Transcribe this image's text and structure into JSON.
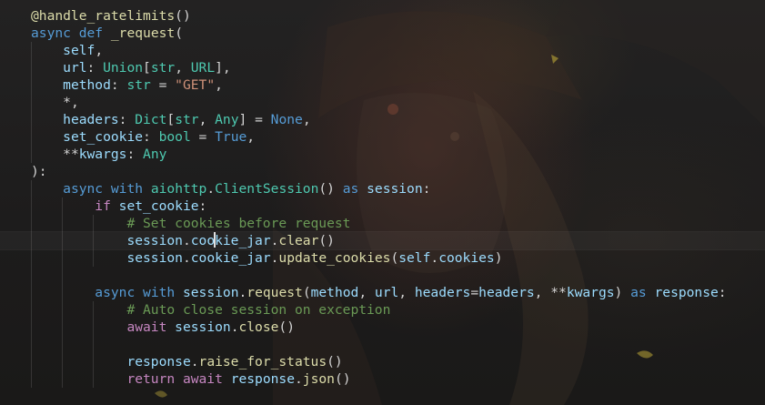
{
  "editor": {
    "language": "python",
    "theme_colors": {
      "keyword": "#569cd6",
      "function": "#dcdcaa",
      "parameter": "#9cdcfe",
      "type": "#4ec9b0",
      "string": "#ce9178",
      "comment": "#6a9955",
      "control": "#c586c0",
      "text": "#d4d4d4"
    },
    "cursor": {
      "line": 13,
      "column": 23
    },
    "lines": [
      {
        "indent": 0,
        "tokens": [
          {
            "t": "@handle_ratelimits",
            "c": "dec"
          },
          {
            "t": "()",
            "c": "pl"
          }
        ]
      },
      {
        "indent": 0,
        "tokens": [
          {
            "t": "async",
            "c": "kw"
          },
          {
            "t": " ",
            "c": "pl"
          },
          {
            "t": "def",
            "c": "kw"
          },
          {
            "t": " ",
            "c": "pl"
          },
          {
            "t": "_request",
            "c": "fn"
          },
          {
            "t": "(",
            "c": "pl"
          }
        ]
      },
      {
        "indent": 1,
        "tokens": [
          {
            "t": "self",
            "c": "par"
          },
          {
            "t": ",",
            "c": "pl"
          }
        ]
      },
      {
        "indent": 1,
        "tokens": [
          {
            "t": "url",
            "c": "par"
          },
          {
            "t": ": ",
            "c": "pl"
          },
          {
            "t": "Union",
            "c": "typ"
          },
          {
            "t": "[",
            "c": "pl"
          },
          {
            "t": "str",
            "c": "typ"
          },
          {
            "t": ", ",
            "c": "pl"
          },
          {
            "t": "URL",
            "c": "typ"
          },
          {
            "t": "],",
            "c": "pl"
          }
        ]
      },
      {
        "indent": 1,
        "tokens": [
          {
            "t": "method",
            "c": "par"
          },
          {
            "t": ": ",
            "c": "pl"
          },
          {
            "t": "str",
            "c": "typ"
          },
          {
            "t": " = ",
            "c": "pl"
          },
          {
            "t": "\"GET\"",
            "c": "str"
          },
          {
            "t": ",",
            "c": "pl"
          }
        ]
      },
      {
        "indent": 1,
        "tokens": [
          {
            "t": "*,",
            "c": "pl"
          }
        ]
      },
      {
        "indent": 1,
        "tokens": [
          {
            "t": "headers",
            "c": "par"
          },
          {
            "t": ": ",
            "c": "pl"
          },
          {
            "t": "Dict",
            "c": "typ"
          },
          {
            "t": "[",
            "c": "pl"
          },
          {
            "t": "str",
            "c": "typ"
          },
          {
            "t": ", ",
            "c": "pl"
          },
          {
            "t": "Any",
            "c": "typ"
          },
          {
            "t": "] = ",
            "c": "pl"
          },
          {
            "t": "None",
            "c": "con"
          },
          {
            "t": ",",
            "c": "pl"
          }
        ]
      },
      {
        "indent": 1,
        "tokens": [
          {
            "t": "set_cookie",
            "c": "par"
          },
          {
            "t": ": ",
            "c": "pl"
          },
          {
            "t": "bool",
            "c": "typ"
          },
          {
            "t": " = ",
            "c": "pl"
          },
          {
            "t": "True",
            "c": "con"
          },
          {
            "t": ",",
            "c": "pl"
          }
        ]
      },
      {
        "indent": 1,
        "tokens": [
          {
            "t": "**",
            "c": "pl"
          },
          {
            "t": "kwargs",
            "c": "par"
          },
          {
            "t": ": ",
            "c": "pl"
          },
          {
            "t": "Any",
            "c": "typ"
          }
        ]
      },
      {
        "indent": 0,
        "tokens": [
          {
            "t": "):",
            "c": "pl"
          }
        ]
      },
      {
        "indent": 1,
        "tokens": [
          {
            "t": "async",
            "c": "kw"
          },
          {
            "t": " ",
            "c": "pl"
          },
          {
            "t": "with",
            "c": "kw"
          },
          {
            "t": " ",
            "c": "pl"
          },
          {
            "t": "aiohttp",
            "c": "typ"
          },
          {
            "t": ".",
            "c": "pl"
          },
          {
            "t": "ClientSession",
            "c": "typ"
          },
          {
            "t": "() ",
            "c": "pl"
          },
          {
            "t": "as",
            "c": "kw"
          },
          {
            "t": " ",
            "c": "pl"
          },
          {
            "t": "session",
            "c": "var"
          },
          {
            "t": ":",
            "c": "pl"
          }
        ]
      },
      {
        "indent": 2,
        "tokens": [
          {
            "t": "if",
            "c": "ctl"
          },
          {
            "t": " ",
            "c": "pl"
          },
          {
            "t": "set_cookie",
            "c": "var"
          },
          {
            "t": ":",
            "c": "pl"
          }
        ]
      },
      {
        "indent": 3,
        "tokens": [
          {
            "t": "# Set cookies before request",
            "c": "cm"
          }
        ]
      },
      {
        "indent": 3,
        "tokens": [
          {
            "t": "session",
            "c": "var"
          },
          {
            "t": ".",
            "c": "pl"
          },
          {
            "t": "cookie_jar",
            "c": "var"
          },
          {
            "t": ".",
            "c": "pl"
          },
          {
            "t": "clear",
            "c": "fn"
          },
          {
            "t": "()",
            "c": "pl"
          }
        ]
      },
      {
        "indent": 3,
        "tokens": [
          {
            "t": "session",
            "c": "var"
          },
          {
            "t": ".",
            "c": "pl"
          },
          {
            "t": "cookie_jar",
            "c": "var"
          },
          {
            "t": ".",
            "c": "pl"
          },
          {
            "t": "update_cookies",
            "c": "fn"
          },
          {
            "t": "(",
            "c": "pl"
          },
          {
            "t": "self",
            "c": "var"
          },
          {
            "t": ".",
            "c": "pl"
          },
          {
            "t": "cookies",
            "c": "var"
          },
          {
            "t": ")",
            "c": "pl"
          }
        ]
      },
      {
        "indent": 2,
        "tokens": []
      },
      {
        "indent": 2,
        "tokens": [
          {
            "t": "async",
            "c": "kw"
          },
          {
            "t": " ",
            "c": "pl"
          },
          {
            "t": "with",
            "c": "kw"
          },
          {
            "t": " ",
            "c": "pl"
          },
          {
            "t": "session",
            "c": "var"
          },
          {
            "t": ".",
            "c": "pl"
          },
          {
            "t": "request",
            "c": "fn"
          },
          {
            "t": "(",
            "c": "pl"
          },
          {
            "t": "method",
            "c": "var"
          },
          {
            "t": ", ",
            "c": "pl"
          },
          {
            "t": "url",
            "c": "var"
          },
          {
            "t": ", ",
            "c": "pl"
          },
          {
            "t": "headers",
            "c": "par"
          },
          {
            "t": "=",
            "c": "pl"
          },
          {
            "t": "headers",
            "c": "var"
          },
          {
            "t": ", ",
            "c": "pl"
          },
          {
            "t": "**",
            "c": "pl"
          },
          {
            "t": "kwargs",
            "c": "var"
          },
          {
            "t": ") ",
            "c": "pl"
          },
          {
            "t": "as",
            "c": "kw"
          },
          {
            "t": " ",
            "c": "pl"
          },
          {
            "t": "response",
            "c": "var"
          },
          {
            "t": ":",
            "c": "pl"
          }
        ]
      },
      {
        "indent": 3,
        "tokens": [
          {
            "t": "# Auto close session on exception",
            "c": "cm"
          }
        ]
      },
      {
        "indent": 3,
        "tokens": [
          {
            "t": "await",
            "c": "ctl"
          },
          {
            "t": " ",
            "c": "pl"
          },
          {
            "t": "session",
            "c": "var"
          },
          {
            "t": ".",
            "c": "pl"
          },
          {
            "t": "close",
            "c": "fn"
          },
          {
            "t": "()",
            "c": "pl"
          }
        ]
      },
      {
        "indent": 3,
        "tokens": []
      },
      {
        "indent": 3,
        "tokens": [
          {
            "t": "response",
            "c": "var"
          },
          {
            "t": ".",
            "c": "pl"
          },
          {
            "t": "raise_for_status",
            "c": "fn"
          },
          {
            "t": "()",
            "c": "pl"
          }
        ]
      },
      {
        "indent": 3,
        "tokens": [
          {
            "t": "return",
            "c": "ctl"
          },
          {
            "t": " ",
            "c": "pl"
          },
          {
            "t": "await",
            "c": "ctl"
          },
          {
            "t": " ",
            "c": "pl"
          },
          {
            "t": "response",
            "c": "var"
          },
          {
            "t": ".",
            "c": "pl"
          },
          {
            "t": "json",
            "c": "fn"
          },
          {
            "t": "()",
            "c": "pl"
          }
        ]
      }
    ]
  }
}
